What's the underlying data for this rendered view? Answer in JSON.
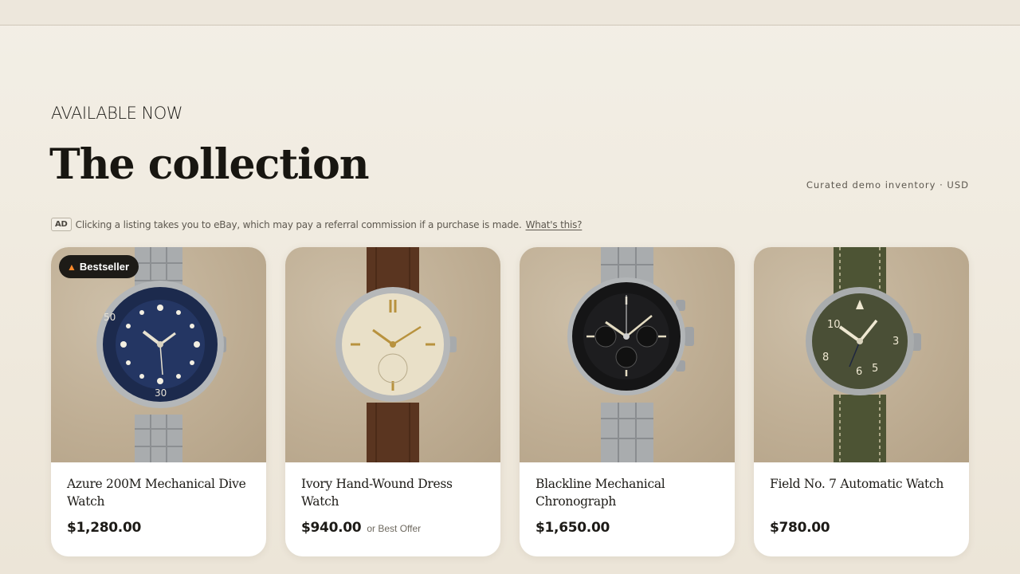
{
  "header": {
    "eyebrow": "AVAILABLE NOW",
    "title": "The collection",
    "meta": "Curated demo inventory · USD"
  },
  "disclosure": {
    "badge": "AD",
    "text": "Clicking a listing takes you to eBay, which may pay a referral commission if a purchase is made.",
    "link": "What's this?"
  },
  "products": [
    {
      "name": "Azure 200M Mechanical Dive Watch",
      "price": "$1,280.00",
      "badge": "Bestseller",
      "badge_icon": "flame-icon",
      "offer": ""
    },
    {
      "name": "Ivory Hand-Wound Dress Watch",
      "price": "$940.00",
      "badge": "",
      "offer": "or Best Offer"
    },
    {
      "name": "Blackline Mechanical Chronograph",
      "price": "$1,650.00",
      "badge": "",
      "offer": ""
    },
    {
      "name": "Field No. 7 Automatic Watch",
      "price": "$780.00",
      "badge": "",
      "offer": ""
    }
  ],
  "colors": {
    "background": "#f0eadf",
    "card": "#ffffff",
    "badge_bg": "#1d1b17",
    "dial_blue": "#1f2f55",
    "dial_ivory": "#e9e0c8",
    "dial_black": "#1b1b1c",
    "dial_green": "#4a4f36"
  }
}
